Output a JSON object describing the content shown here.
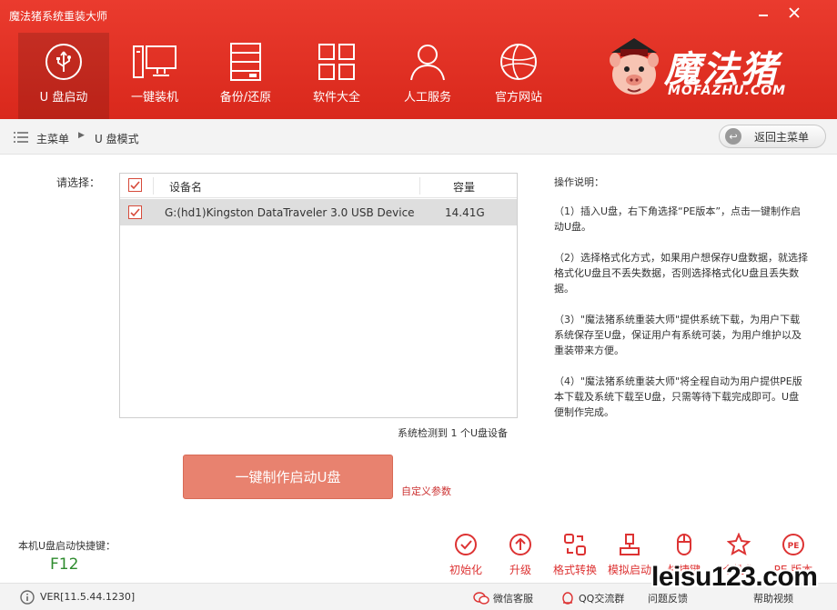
{
  "window": {
    "title": "魔法猪系统重装大师",
    "minimize_icon": "minimize-icon",
    "close_icon": "close-icon"
  },
  "nav": {
    "items": [
      {
        "label": "U 盘启动",
        "icon": "usb-icon",
        "active": true
      },
      {
        "label": "一键装机",
        "icon": "computer-icon"
      },
      {
        "label": "备份/还原",
        "icon": "server-icon"
      },
      {
        "label": "软件大全",
        "icon": "apps-grid-icon"
      },
      {
        "label": "人工服务",
        "icon": "person-icon"
      },
      {
        "label": "官方网站",
        "icon": "globe-icon"
      }
    ]
  },
  "logo": {
    "cn": "魔法猪",
    "en": "MOFAZHU.COM"
  },
  "breadcrumb": {
    "home": "主菜单",
    "current": "U 盘模式",
    "back_label": "返回主菜单"
  },
  "main": {
    "select_label": "请选择：",
    "table": {
      "columns": [
        "设备名",
        "容量"
      ],
      "rows": [
        {
          "checked": true,
          "name": "G:(hd1)Kingston DataTraveler 3.0 USB Device",
          "size": "14.41G"
        }
      ]
    },
    "detect_text": "系统检测到 1 个U盘设备",
    "make_button": "一键制作启动U盘",
    "custom_link": "自定义参数"
  },
  "instructions": {
    "title": "操作说明：",
    "paragraphs": [
      "（1）插入U盘，右下角选择“PE版本”，点击一键制作启动U盘。",
      "（2）选择格式化方式，如果用户想保存U盘数据，就选择格式化U盘且不丢失数据，否则选择格式化U盘且丢失数据。",
      "（3）\"魔法猪系统重装大师\"提供系统下载，为用户下载系统保存至U盘，保证用户有系统可装，为用户维护以及重装带来方便。",
      "（4）\"魔法猪系统重装大师\"将全程自动为用户提供PE版本下载及系统下载至U盘，只需等待下载完成即可。U盘便制作完成。"
    ]
  },
  "shortcut": {
    "label": "本机U盘启动快捷键：",
    "key": "F12"
  },
  "tools": [
    {
      "label": "初始化",
      "icon": "check-circle-icon"
    },
    {
      "label": "升级",
      "icon": "upload-circle-icon"
    },
    {
      "label": "格式转换",
      "icon": "convert-icon"
    },
    {
      "label": "模拟启动",
      "icon": "simulate-icon"
    },
    {
      "label": "快捷键",
      "icon": "mouse-icon"
    },
    {
      "label": "个性化",
      "icon": "personalize-icon"
    },
    {
      "label": "PE 版本",
      "icon": "pe-icon"
    }
  ],
  "footer": {
    "version": "VER[11.5.44.1230]",
    "wechat": "微信客服",
    "qq": "QQ交流群",
    "feedback": "问题反馈",
    "help": "帮助视频"
  },
  "watermark": "leisu123.com",
  "colors": {
    "header": "#e2342a",
    "accent": "#d33",
    "button": "#e8826f",
    "shortcut": "#2e8b2e"
  }
}
